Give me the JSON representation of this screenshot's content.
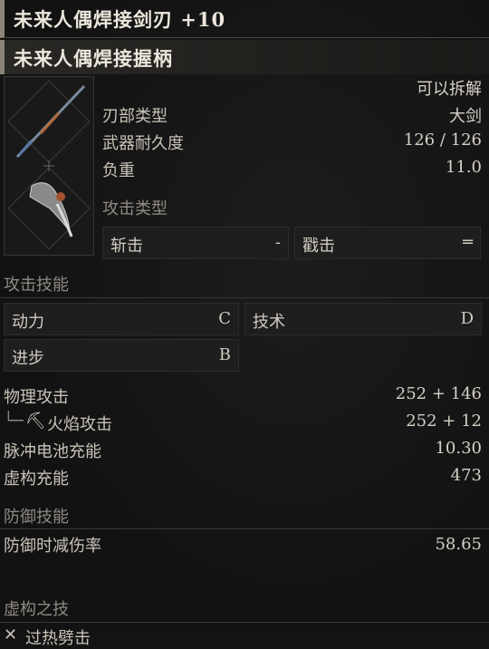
{
  "header": {
    "title": "未来人偶焊接剑刃 +10",
    "subtitle": "未来人偶焊接握柄"
  },
  "info": {
    "disassemble": "可以拆解",
    "blade_type_label": "刃部类型",
    "blade_type_value": "大剑",
    "durability_label": "武器耐久度",
    "durability_value": "126 / 126",
    "weight_label": "负重",
    "weight_value": "11.0"
  },
  "attack_type": {
    "section": "攻击类型",
    "slash_label": "斩击",
    "slash_value": "-",
    "pierce_label": "戳击",
    "pierce_value": "═"
  },
  "attack_skills": {
    "section": "攻击技能",
    "power_label": "动力",
    "power_value": "C",
    "technique_label": "技术",
    "technique_value": "D",
    "advance_label": "进步",
    "advance_value": "B"
  },
  "stats": {
    "physical_label": "物理攻击",
    "physical_value": "252 + 146",
    "fire_label": "火焰攻击",
    "fire_value": "252 + 12",
    "battery_label": "脉冲电池充能",
    "battery_value": "10.30",
    "fable_label": "虚构充能",
    "fable_value": "473"
  },
  "defense": {
    "section": "防御技能",
    "guard_label": "防御时减伤率",
    "guard_value": "58.65"
  },
  "fable_art": {
    "section": "虚构之技",
    "item": "过热劈击"
  }
}
